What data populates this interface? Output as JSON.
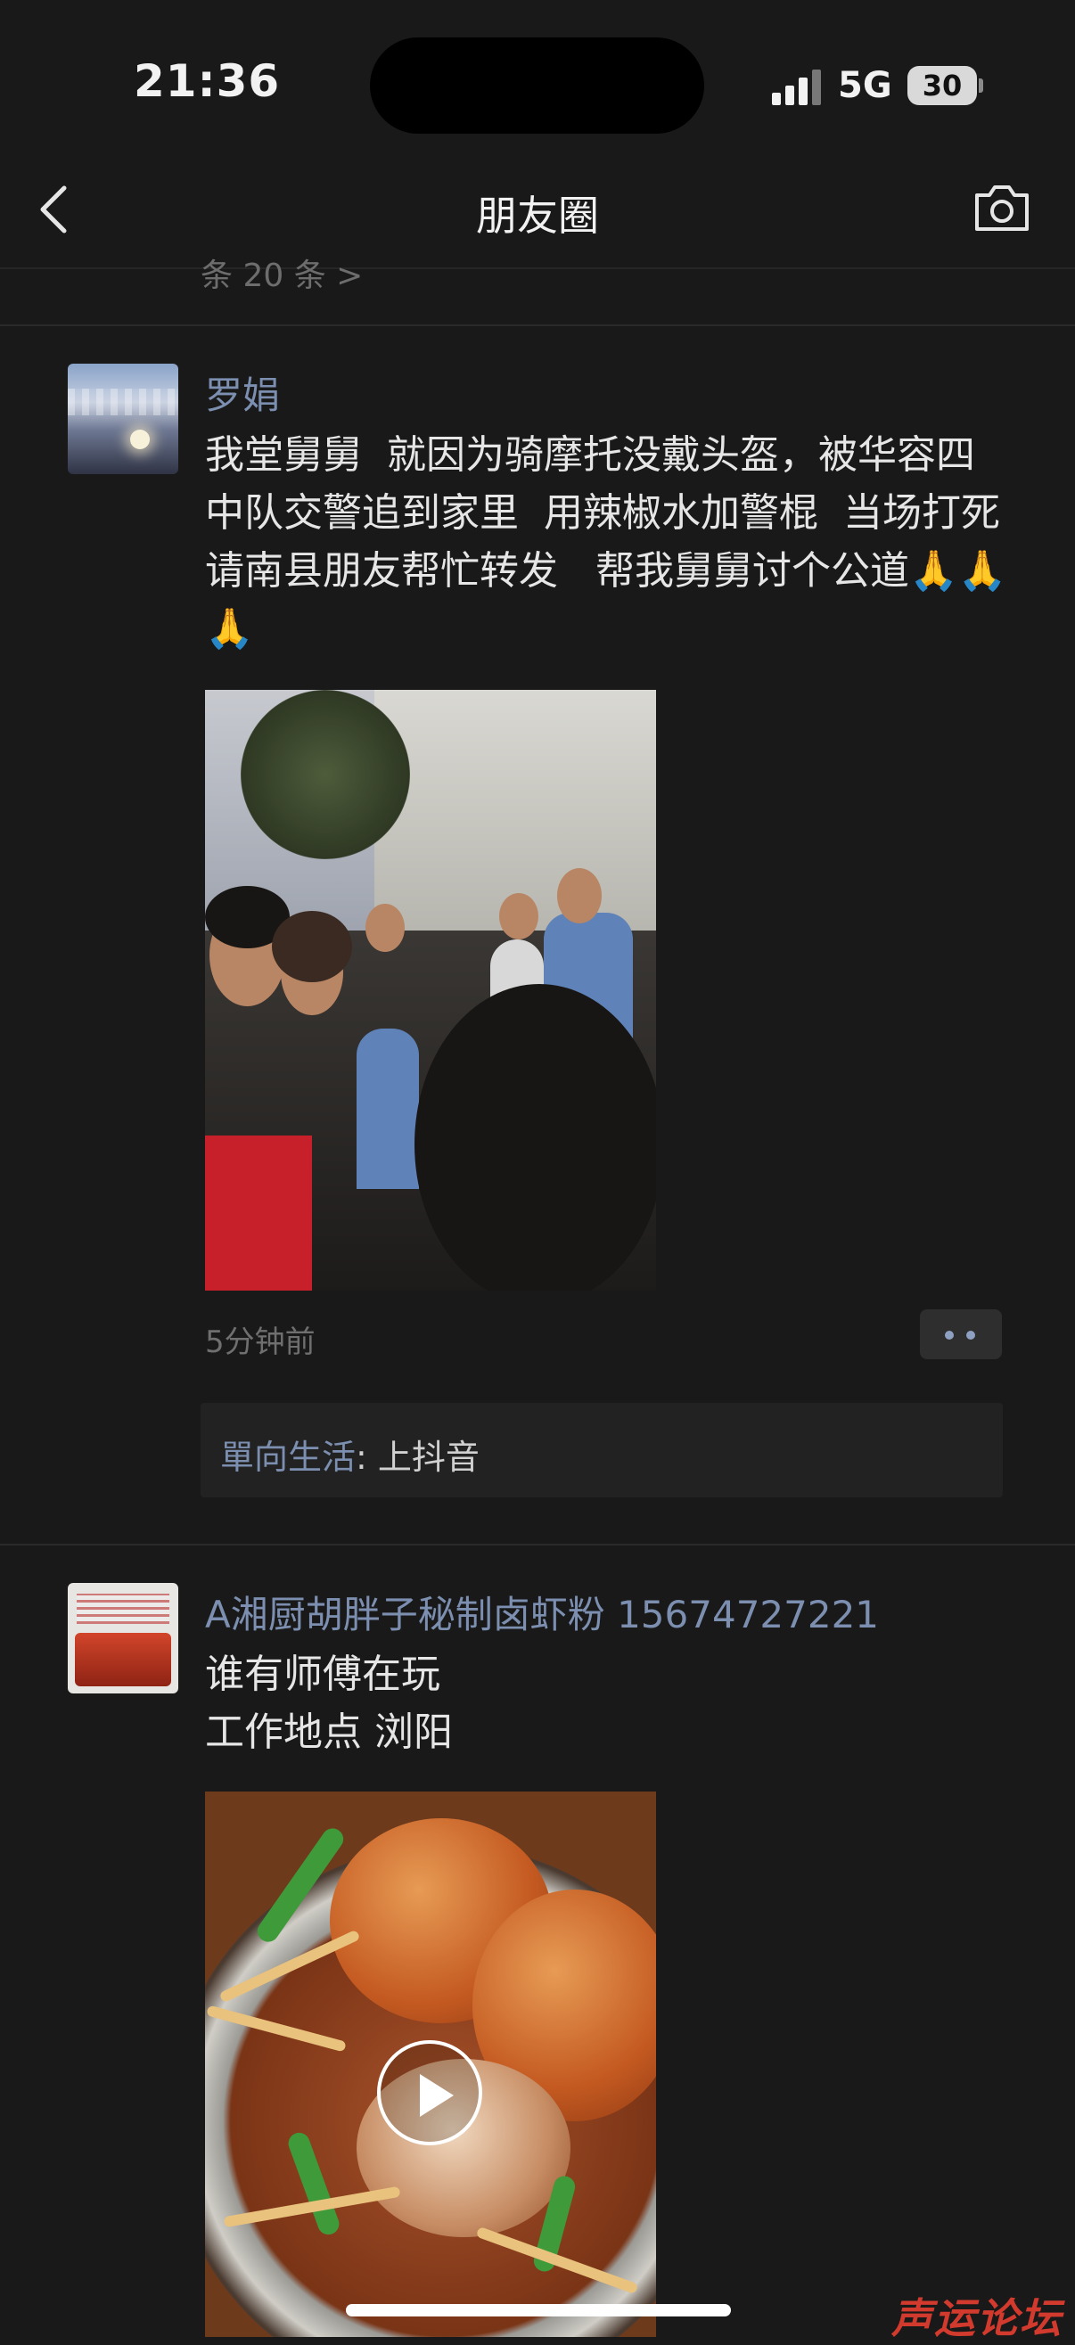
{
  "status_bar": {
    "time": "21:36",
    "network": "5G",
    "battery": "30"
  },
  "nav": {
    "title": "朋友圈",
    "back_icon": "chevron-left-icon",
    "camera_icon": "camera-icon"
  },
  "previous_post_peek": "条  20 条  >",
  "posts": [
    {
      "author": "罗娟",
      "text": "我堂舅舅  就因为骑摩托没戴头盔，被华容四中队交警追到家里  用辣椒水加警棍  当场打死  请南县朋友帮忙转发   帮我舅舅讨个公道🙏🙏🙏",
      "time": "5分钟前",
      "comment": {
        "author": "單向生活",
        "separator": ": ",
        "text": "上抖音"
      }
    },
    {
      "author": "A湘厨胡胖子秘制卤虾粉 15674727221",
      "text": "谁有师傅在玩\n工作地点 浏阳",
      "media": "video"
    }
  ],
  "watermark": "声运论坛"
}
